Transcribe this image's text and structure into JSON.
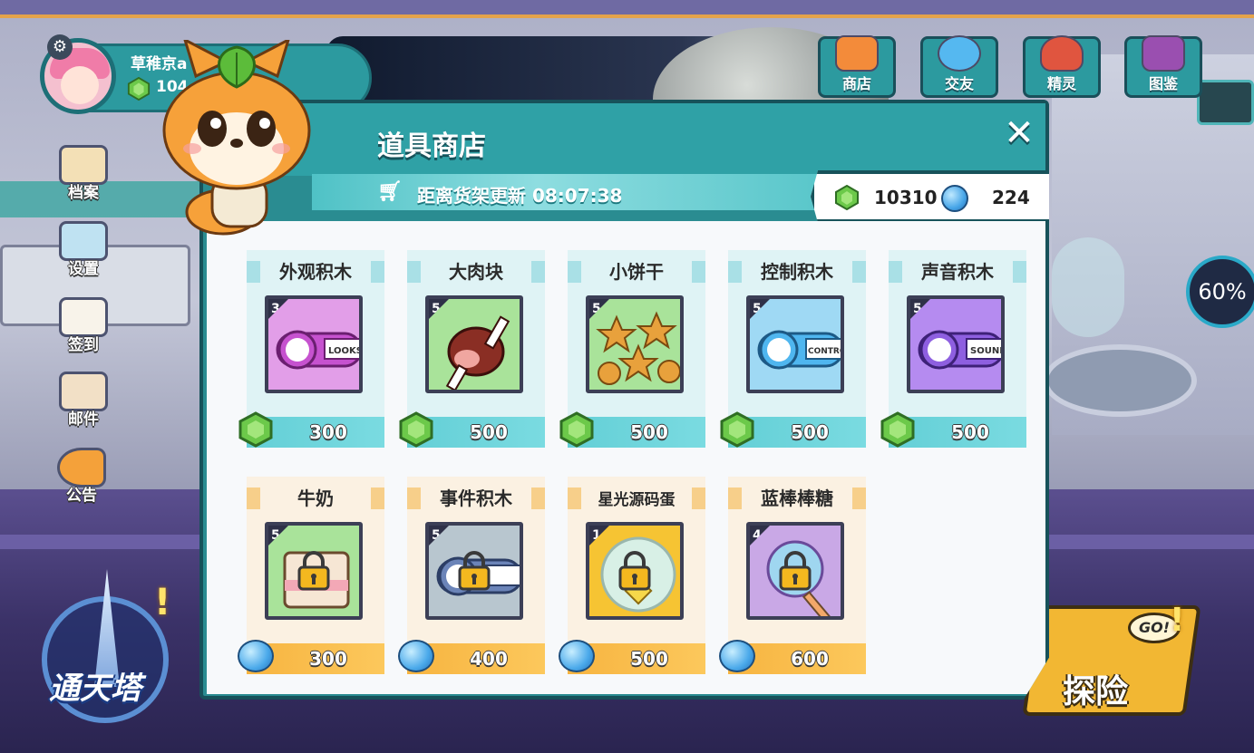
{
  "player": {
    "name": "草稚京a",
    "coins": "104"
  },
  "left_menu": [
    {
      "key": "archive",
      "label": "档案"
    },
    {
      "key": "settings",
      "label": "设置"
    },
    {
      "key": "checkin",
      "label": "签到"
    },
    {
      "key": "mail",
      "label": "邮件"
    },
    {
      "key": "notice",
      "label": "公告"
    }
  ],
  "top_nav": [
    {
      "key": "shop",
      "label": "商店"
    },
    {
      "key": "social",
      "label": "交友"
    },
    {
      "key": "spirit",
      "label": "精灵"
    },
    {
      "key": "codex",
      "label": "图鉴"
    }
  ],
  "gauge": {
    "value": "60%"
  },
  "tower": {
    "label": "通天塔",
    "alert": "!"
  },
  "explore": {
    "label": "探险",
    "go": "GO!",
    "alert": "!"
  },
  "shop": {
    "title": "道具商店",
    "close": "✕",
    "refresh_text": "距离货架更新 08:07:38",
    "gems": "10310",
    "balls": "224",
    "items": [
      {
        "name": "外观积木",
        "count": "3",
        "price": "300",
        "currency": "gem",
        "locked": false,
        "icon": "looks-block-icon"
      },
      {
        "name": "大肉块",
        "count": "5",
        "price": "500",
        "currency": "gem",
        "locked": false,
        "icon": "meat-icon"
      },
      {
        "name": "小饼干",
        "count": "5",
        "price": "500",
        "currency": "gem",
        "locked": false,
        "icon": "cookies-icon"
      },
      {
        "name": "控制积木",
        "count": "5",
        "price": "500",
        "currency": "gem",
        "locked": false,
        "icon": "control-block-icon"
      },
      {
        "name": "声音积木",
        "count": "5",
        "price": "500",
        "currency": "gem",
        "locked": false,
        "icon": "sound-block-icon"
      },
      {
        "name": "牛奶",
        "count": "5",
        "price": "300",
        "currency": "ball",
        "locked": true,
        "icon": "milk-icon"
      },
      {
        "name": "事件积木",
        "count": "5",
        "price": "400",
        "currency": "ball",
        "locked": true,
        "icon": "events-block-icon"
      },
      {
        "name": "星光源码蛋",
        "count": "1",
        "price": "500",
        "currency": "ball",
        "locked": true,
        "icon": "star-egg-icon"
      },
      {
        "name": "蓝棒棒糖",
        "count": "4",
        "price": "600",
        "currency": "ball",
        "locked": true,
        "icon": "lollipop-icon"
      }
    ]
  },
  "colors": {
    "looks": "#d86ad8",
    "meat": "#8a2e24",
    "cookies": "#e8a13c",
    "control": "#4fb6ef",
    "sound": "#8e5fe0",
    "lock": "#f4b81f"
  }
}
